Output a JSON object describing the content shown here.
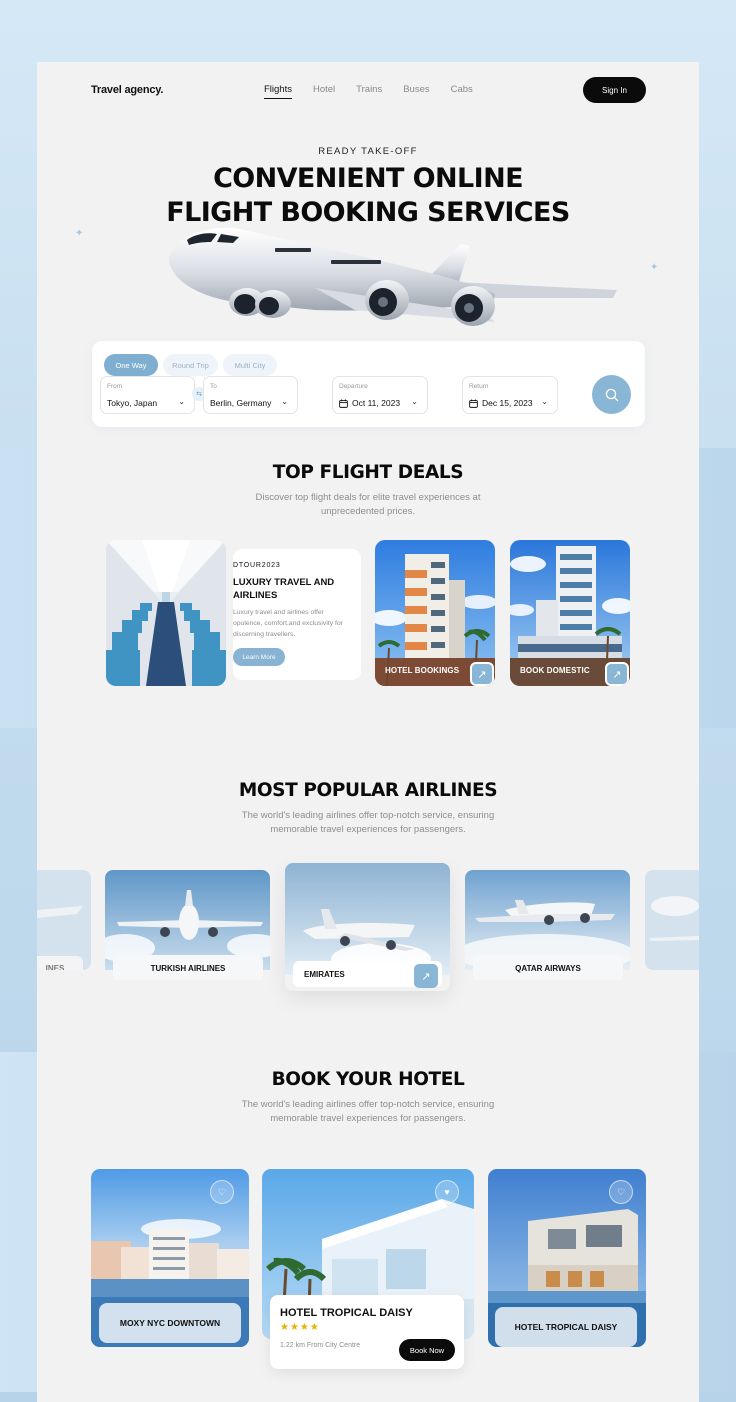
{
  "brand": "Travel agency.",
  "nav": [
    "Flights",
    "Hotel",
    "Trains",
    "Buses",
    "Cabs"
  ],
  "signin": "Sign In",
  "hero": {
    "kicker": "READY TAKE-OFF",
    "line1": "CONVENIENT ONLINE",
    "line2": "FLIGHT BOOKING SERVICES"
  },
  "search": {
    "tabs": [
      "One Way",
      "Round Trip",
      "Multi City"
    ],
    "from": {
      "label": "From",
      "value": "Tokyo, Japan"
    },
    "to": {
      "label": "To",
      "value": "Berlin, Germany"
    },
    "departure": {
      "label": "Departure",
      "value": "Oct 11, 2023"
    },
    "return": {
      "label": "Return",
      "value": "Dec 15, 2023"
    }
  },
  "deals": {
    "title": "TOP FLIGHT DEALS",
    "desc": "Discover top flight deals for elite travel experiences at unprecedented prices.",
    "card": {
      "code": "DTOUR2023",
      "title": "LUXURY TRAVEL AND AIRLINES",
      "desc": "Luxury travel and airlines offer opulence, comfort,and exclusivity for discerning travellers.",
      "button": "Learn More"
    },
    "tiles": [
      "HOTEL BOOKINGS",
      "BOOK DOMESTIC"
    ]
  },
  "airlines": {
    "title": "MOST POPULAR AIRLINES",
    "desc": "The world's leading airlines offer top-notch service, ensuring memorable travel experiences for passengers.",
    "items": [
      "INES",
      "TURKISH AIRLINES",
      "EMIRATES",
      "QATAR AIRWAYS"
    ]
  },
  "hotels": {
    "title": "BOOK YOUR HOTEL",
    "desc": "The world's leading airlines offer top-notch service, ensuring memorable travel experiences for passengers.",
    "left": "MOXY NYC DOWNTOWN",
    "right": "HOTEL TROPICAL DAISY",
    "featured": {
      "name": "HOTEL TROPICAL DAISY",
      "distance": "1.22 km From City Centre",
      "button": "Book Now",
      "rating": 4
    }
  }
}
